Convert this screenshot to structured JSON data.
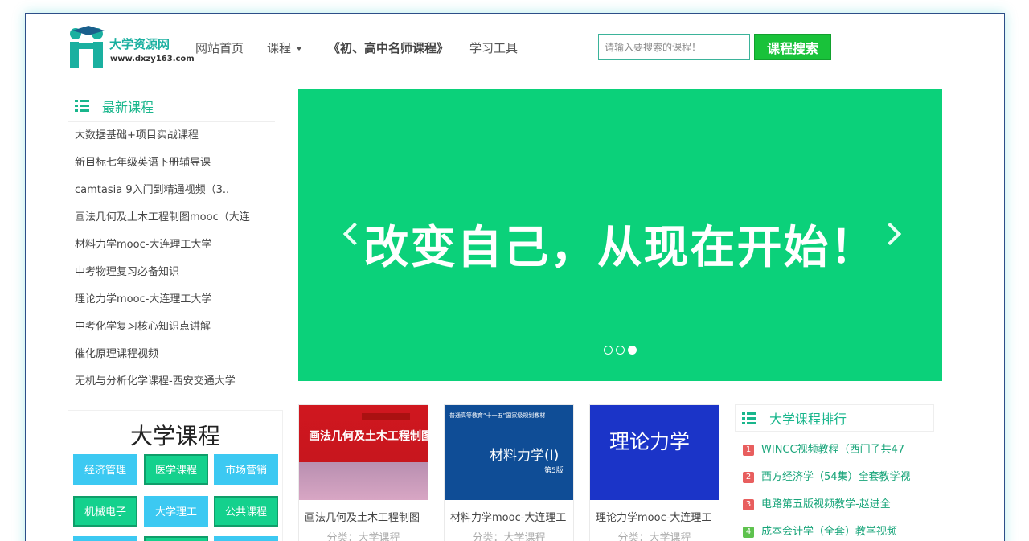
{
  "header": {
    "logo_name": "大学资源网",
    "logo_url": "www.dxzy163.com",
    "nav": [
      {
        "label": "网站首页"
      },
      {
        "label": "课程"
      },
      {
        "label": "《初、高中名师课程》"
      },
      {
        "label": "学习工具"
      }
    ],
    "search": {
      "placeholder": "请输入要搜索的课程！",
      "button_label": "课程搜索"
    }
  },
  "latest": {
    "title": "最新课程",
    "items": [
      "大数据基础+项目实战课程",
      "新目标七年级英语下册辅导课",
      "camtasia 9入门到精通视频（3..",
      "画法几何及土木工程制图mooc（大连",
      "材料力学mooc-大连理工大学",
      "中考物理复习必备知识",
      "理论力学mooc-大连理工大学",
      "中考化学复习核心知识点讲解",
      "催化原理课程视频",
      "无机与分析化学课程-西安交通大学"
    ]
  },
  "carousel": {
    "slogan": "改变自己，从现在开始！",
    "slide_count": 3,
    "active_slide": 3,
    "background_color": "#0bd17a"
  },
  "categories": {
    "title": "大学课程",
    "buttons": [
      {
        "label": "经济管理",
        "style": "blue"
      },
      {
        "label": "医学课程",
        "style": "green"
      },
      {
        "label": "市场营销",
        "style": "blue"
      },
      {
        "label": "机械电子",
        "style": "green"
      },
      {
        "label": "大学理工",
        "style": "blue"
      },
      {
        "label": "公共课程",
        "style": "green"
      }
    ]
  },
  "cards": [
    {
      "cover_text": "画法几何及土木工程制图",
      "title": "画法几何及土木工程制图",
      "category": "分类：大学课程"
    },
    {
      "cover_top": "普通高等教育“十一五”国家级规划教材",
      "cover_text": "材料力学(I)",
      "cover_sub": "第5版",
      "title": "材料力学mooc-大连理工",
      "category": "分类：大学课程"
    },
    {
      "cover_text": "理论力学",
      "title": "理论力学mooc-大连理工",
      "category": "分类：大学课程"
    }
  ],
  "ranking": {
    "title": "大学课程排行",
    "items": [
      {
        "rank": "1",
        "title": "WINCC视频教程（西门子共47",
        "color": "red"
      },
      {
        "rank": "2",
        "title": "西方经济学（54集）全套教学视",
        "color": "red"
      },
      {
        "rank": "3",
        "title": "电路第五版视频教学-赵进全",
        "color": "red"
      },
      {
        "rank": "4",
        "title": "成本会计学（全套）教学视频",
        "color": "green"
      }
    ]
  },
  "colors": {
    "accent_green": "#19b68c",
    "search_button": "#19c23a",
    "category_blue": "#3cc9f2",
    "category_green": "#14d18d"
  }
}
